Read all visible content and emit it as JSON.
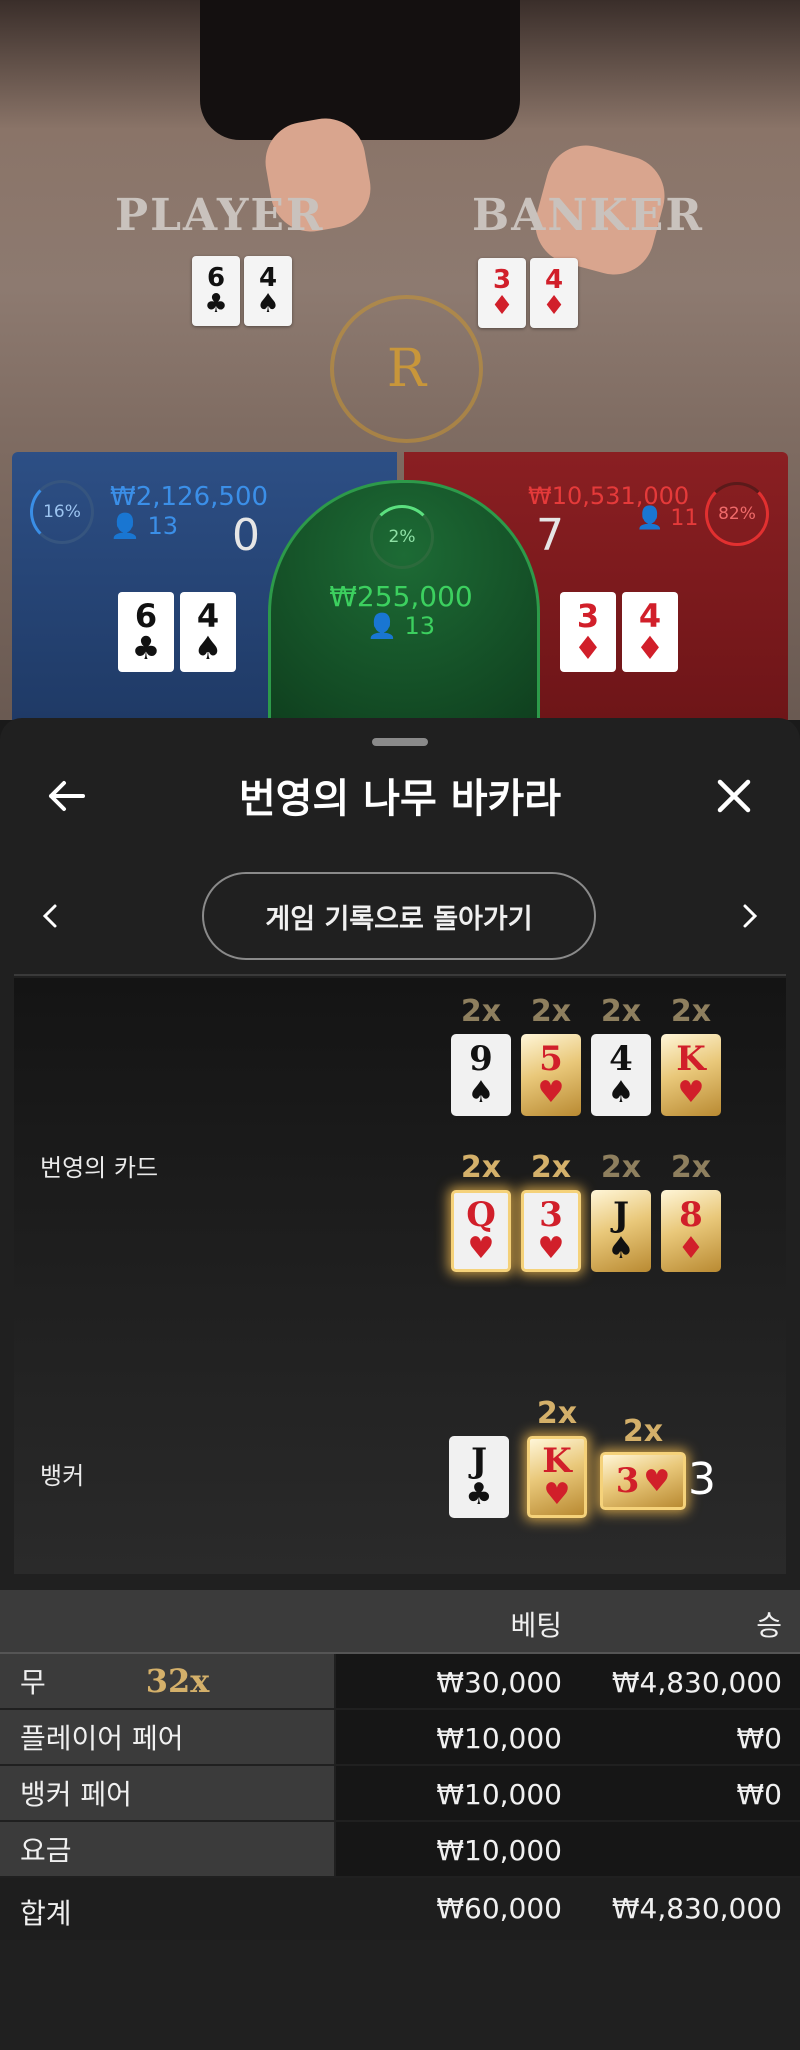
{
  "video": {
    "player_text": "PLAYER",
    "banker_text": "BANKER",
    "logo_letter": "R",
    "player_cards": [
      {
        "rank": "6",
        "suit": "♣"
      },
      {
        "rank": "4",
        "suit": "♠"
      }
    ],
    "banker_cards": [
      {
        "rank": "3",
        "suit": "♦"
      },
      {
        "rank": "4",
        "suit": "♦"
      }
    ]
  },
  "bets": {
    "player": {
      "percent": "16%",
      "amount": "₩2,126,500",
      "count": "13",
      "score": "0",
      "cards": [
        {
          "rank": "6",
          "suit": "♣"
        },
        {
          "rank": "4",
          "suit": "♠"
        }
      ]
    },
    "tie": {
      "percent": "2%",
      "amount": "₩255,000",
      "count": "13"
    },
    "banker": {
      "percent": "82%",
      "amount": "₩10,531,000",
      "count": "11",
      "score": "7",
      "cards": [
        {
          "rank": "3",
          "suit": "♦"
        },
        {
          "rank": "4",
          "suit": "♦"
        }
      ]
    }
  },
  "sheet": {
    "title": "번영의 나무 바카라",
    "back_icon": "arrow-left-icon",
    "close_icon": "close-icon",
    "history_button": "게임 기록으로 돌아가기",
    "prev_icon": "chevron-left-icon",
    "next_icon": "chevron-right-icon"
  },
  "prosperity": {
    "label": "번영의 카드",
    "rows": [
      [
        {
          "mult": "2x",
          "active": false,
          "rank": "9",
          "suit": "♠",
          "color": "black",
          "style": "plain"
        },
        {
          "mult": "2x",
          "active": false,
          "rank": "5",
          "suit": "♥",
          "color": "red",
          "style": "gold"
        },
        {
          "mult": "2x",
          "active": false,
          "rank": "4",
          "suit": "♠",
          "color": "black",
          "style": "plain"
        },
        {
          "mult": "2x",
          "active": false,
          "rank": "K",
          "suit": "♥",
          "color": "red",
          "style": "gold"
        }
      ],
      [
        {
          "mult": "2x",
          "active": true,
          "rank": "Q",
          "suit": "♥",
          "color": "red",
          "style": "plain"
        },
        {
          "mult": "2x",
          "active": true,
          "rank": "3",
          "suit": "♥",
          "color": "red",
          "style": "plain"
        },
        {
          "mult": "2x",
          "active": false,
          "rank": "J",
          "suit": "♠",
          "color": "black",
          "style": "gold"
        },
        {
          "mult": "2x",
          "active": false,
          "rank": "8",
          "suit": "♦",
          "color": "red",
          "style": "gold"
        }
      ]
    ]
  },
  "banker_hand": {
    "label": "뱅커",
    "cards": [
      {
        "mult": "",
        "rank": "J",
        "suit": "♣",
        "color": "black",
        "style": "plain"
      },
      {
        "mult": "2x",
        "rank": "K",
        "suit": "♥",
        "color": "red",
        "style": "gold"
      },
      {
        "mult": "2x",
        "rank": "3",
        "suit": "♥",
        "color": "red",
        "style": "gold"
      }
    ],
    "score": "3"
  },
  "results": {
    "headers": {
      "bet": "베팅",
      "win": "승"
    },
    "rows": [
      {
        "label": "무",
        "multiplier": "32x",
        "bet": "₩30,000",
        "win": "₩4,830,000"
      },
      {
        "label": "플레이어 페어",
        "multiplier": "",
        "bet": "₩10,000",
        "win": "₩0"
      },
      {
        "label": "뱅커 페어",
        "multiplier": "",
        "bet": "₩10,000",
        "win": "₩0"
      },
      {
        "label": "요금",
        "multiplier": "",
        "bet": "₩10,000",
        "win": ""
      }
    ],
    "total": {
      "label": "합계",
      "bet": "₩60,000",
      "win": "₩4,830,000"
    }
  }
}
